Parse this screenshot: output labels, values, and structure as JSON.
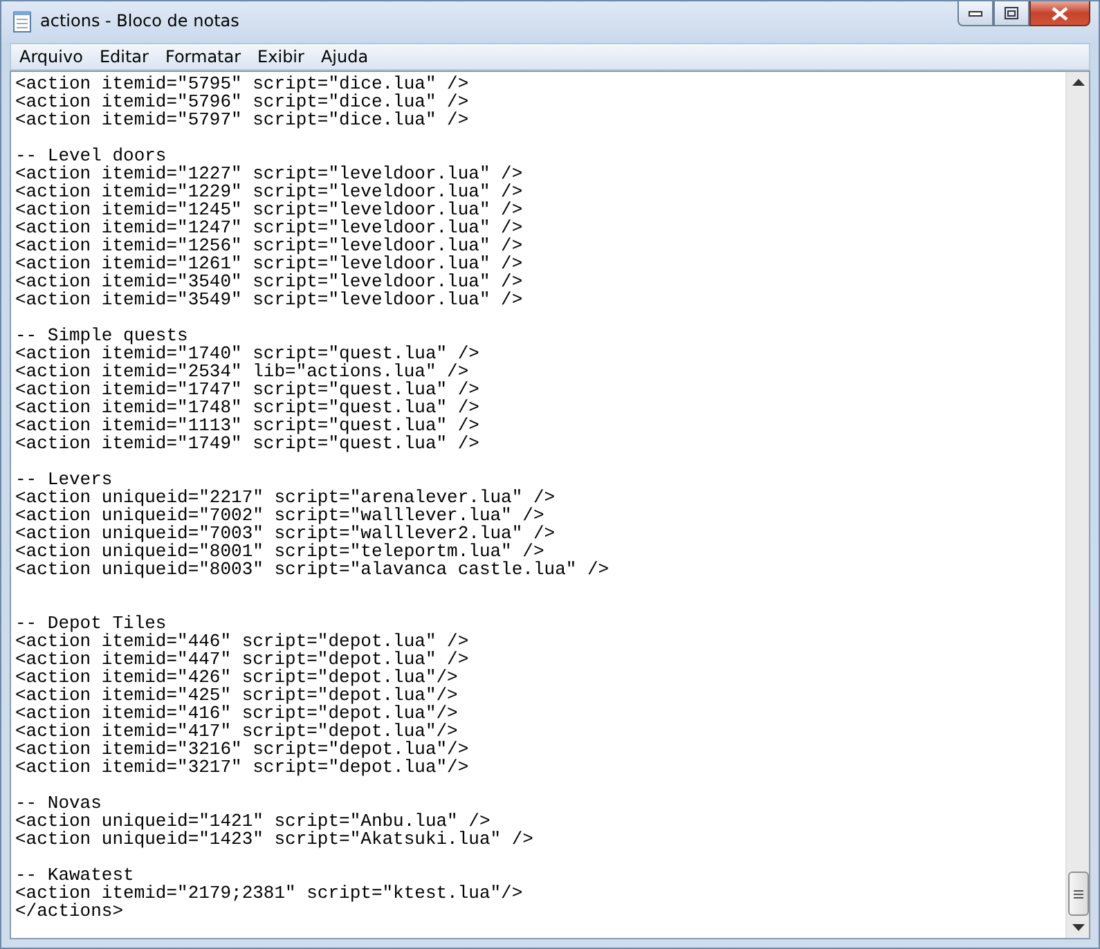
{
  "window": {
    "title": "actions - Bloco de notas"
  },
  "menu": [
    "Arquivo",
    "Editar",
    "Formatar",
    "Exibir",
    "Ajuda"
  ],
  "lines": [
    {
      "kind": "text",
      "text": "<action itemid=\"5795\" script=\"dice.lua\" />"
    },
    {
      "kind": "text",
      "text": "<action itemid=\"5796\" script=\"dice.lua\" />"
    },
    {
      "kind": "text",
      "text": "<action itemid=\"5797\" script=\"dice.lua\" />"
    },
    {
      "kind": "blank"
    },
    {
      "kind": "text",
      "text": "-- Level doors"
    },
    {
      "kind": "text",
      "text": "<action itemid=\"1227\" script=\"leveldoor.lua\" />"
    },
    {
      "kind": "text",
      "text": "<action itemid=\"1229\" script=\"leveldoor.lua\" />"
    },
    {
      "kind": "text",
      "text": "<action itemid=\"1245\" script=\"leveldoor.lua\" />"
    },
    {
      "kind": "text",
      "text": "<action itemid=\"1247\" script=\"leveldoor.lua\" />"
    },
    {
      "kind": "text",
      "text": "<action itemid=\"1256\" script=\"leveldoor.lua\" />"
    },
    {
      "kind": "text",
      "text": "<action itemid=\"1261\" script=\"leveldoor.lua\" />"
    },
    {
      "kind": "text",
      "text": "<action itemid=\"3540\" script=\"leveldoor.lua\" />"
    },
    {
      "kind": "text",
      "text": "<action itemid=\"3549\" script=\"leveldoor.lua\" />"
    },
    {
      "kind": "blank"
    },
    {
      "kind": "text",
      "text": "-- Simple quests"
    },
    {
      "kind": "text",
      "text": "<action itemid=\"1740\" script=\"quest.lua\" />"
    },
    {
      "kind": "text",
      "text": "<action itemid=\"2534\" lib=\"actions.lua\" />"
    },
    {
      "kind": "text",
      "text": "<action itemid=\"1747\" script=\"quest.lua\" />"
    },
    {
      "kind": "text",
      "text": "<action itemid=\"1748\" script=\"quest.lua\" />"
    },
    {
      "kind": "text",
      "text": "<action itemid=\"1113\" script=\"quest.lua\" />"
    },
    {
      "kind": "text",
      "text": "<action itemid=\"1749\" script=\"quest.lua\" />"
    },
    {
      "kind": "blank"
    },
    {
      "kind": "text",
      "text": "-- Levers"
    },
    {
      "kind": "text",
      "text": "<action uniqueid=\"2217\" script=\"arenalever.lua\" />"
    },
    {
      "kind": "text",
      "text": "<action uniqueid=\"7002\" script=\"walllever.lua\" />"
    },
    {
      "kind": "text",
      "text": "<action uniqueid=\"7003\" script=\"walllever2.lua\" />"
    },
    {
      "kind": "text",
      "text": "<action uniqueid=\"8001\" script=\"teleportm.lua\" />"
    },
    {
      "kind": "text",
      "text": "<action uniqueid=\"8003\" script=\"alavanca castle.lua\" />"
    },
    {
      "kind": "blank"
    },
    {
      "kind": "blank"
    },
    {
      "kind": "text",
      "text": "-- Depot Tiles"
    },
    {
      "kind": "text",
      "text": "<action itemid=\"446\" script=\"depot.lua\" />"
    },
    {
      "kind": "text",
      "text": "<action itemid=\"447\" script=\"depot.lua\" />"
    },
    {
      "kind": "text",
      "text": "<action itemid=\"426\" script=\"depot.lua\"/>"
    },
    {
      "kind": "text",
      "text": "<action itemid=\"425\" script=\"depot.lua\"/>"
    },
    {
      "kind": "text",
      "text": "<action itemid=\"416\" script=\"depot.lua\"/>"
    },
    {
      "kind": "text",
      "text": "<action itemid=\"417\" script=\"depot.lua\"/>"
    },
    {
      "kind": "text",
      "text": "<action itemid=\"3216\" script=\"depot.lua\"/>"
    },
    {
      "kind": "text",
      "text": "<action itemid=\"3217\" script=\"depot.lua\"/>"
    },
    {
      "kind": "blank"
    },
    {
      "kind": "text",
      "text": "-- Novas"
    },
    {
      "kind": "text",
      "text": "<action uniqueid=\"1421\" script=\"Anbu.lua\" />"
    },
    {
      "kind": "text",
      "text": "<action uniqueid=\"1423\" script=\"Akatsuki.lua\" />"
    },
    {
      "kind": "blank"
    },
    {
      "kind": "text",
      "text": "-- Kawatest"
    },
    {
      "kind": "text",
      "text": "<action itemid=\"2179;2381\" script=\"ktest.lua\"/>"
    },
    {
      "kind": "text",
      "text": "</actions>"
    }
  ]
}
